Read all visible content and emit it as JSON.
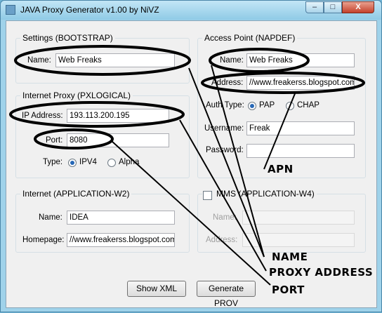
{
  "window": {
    "title": "JAVA Proxy Generator v1.00 by NiVZ",
    "minimize": "–",
    "maximize": "□",
    "close": "X"
  },
  "bootstrap": {
    "legend": "Settings (BOOTSTRAP)",
    "name_label": "Name:",
    "name_value": "Web Freaks"
  },
  "pxlogical": {
    "legend": "Internet Proxy (PXLOGICAL)",
    "ip_label": "IP Address:",
    "ip_value": "193.113.200.195",
    "port_label": "Port:",
    "port_value": "8080",
    "type_label": "Type:",
    "type_options": [
      "IPV4",
      "Alpha"
    ],
    "type_selected": "IPV4"
  },
  "w2": {
    "legend": "Internet (APPLICATION-W2)",
    "name_label": "Name:",
    "name_value": "IDEA",
    "homepage_label": "Homepage:",
    "homepage_value": "//www.freakerss.blogspot.com"
  },
  "napdef": {
    "legend": "Access Point (NAPDEF)",
    "name_label": "Name:",
    "name_value": "Web Freaks",
    "address_label": "Address:",
    "address_value": "//www.freakerss.blogspot.com",
    "auth_label": "Auth Type:",
    "auth_options": [
      "PAP",
      "CHAP"
    ],
    "auth_selected": "PAP",
    "username_label": "Username:",
    "username_value": "Freak",
    "password_label": "Password:",
    "password_value": ""
  },
  "w4": {
    "legend": "MMS (APPLICATION-W4)",
    "checked": false,
    "name_label": "Name:",
    "address_label": "Address:"
  },
  "buttons": {
    "show_xml": "Show XML",
    "generate": "Generate PROV"
  },
  "annotations": {
    "apn": "APN",
    "name": "NAME",
    "proxy_address": "PROXY ADDRESS",
    "port": "PORT"
  }
}
